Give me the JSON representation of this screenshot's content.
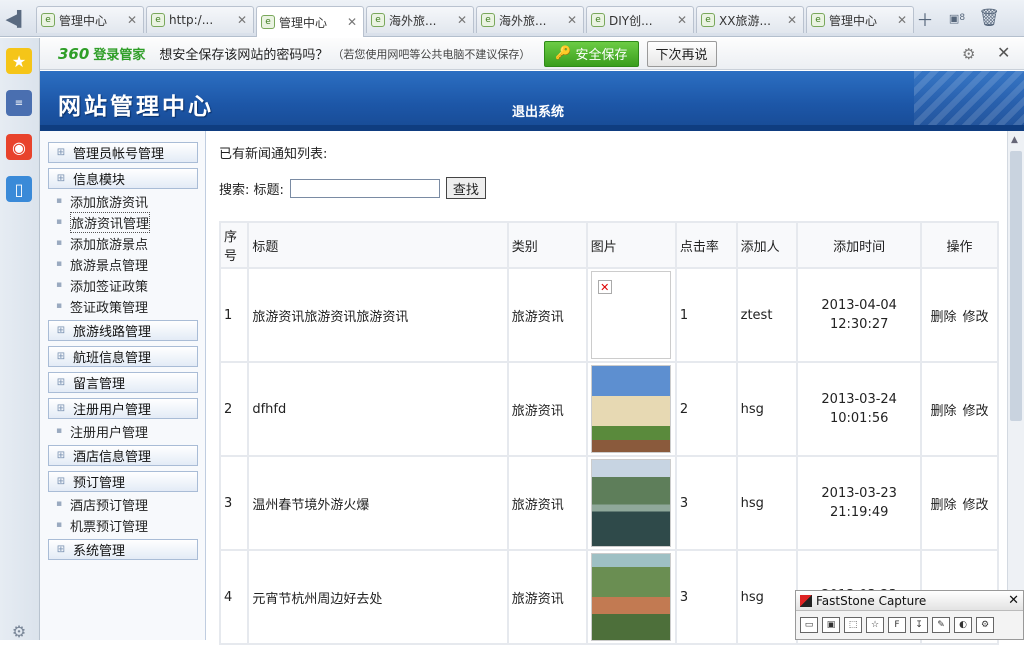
{
  "browser": {
    "tabs": [
      {
        "label": "管理中心",
        "active": false
      },
      {
        "label": "http:/...",
        "active": false
      },
      {
        "label": "管理中心",
        "active": true
      },
      {
        "label": "海外旅...",
        "active": false
      },
      {
        "label": "海外旅...",
        "active": false
      },
      {
        "label": "DIY创...",
        "active": false
      },
      {
        "label": "XX旅游...",
        "active": false
      },
      {
        "label": "管理中心",
        "active": false
      }
    ],
    "tab_count_badge": "8"
  },
  "password_bar": {
    "brand_logo": "360",
    "brand_name": "登录管家",
    "message": "想安全保存该网站的密码吗？",
    "hint": "（若您使用网吧等公共电脑不建议保存）",
    "save_label": "安全保存",
    "later_label": "下次再说"
  },
  "site": {
    "title": "网站管理中心",
    "logout": "退出系统"
  },
  "menu": {
    "items": [
      {
        "type": "head",
        "label": "管理员帐号管理"
      },
      {
        "type": "head",
        "label": "信息模块"
      },
      {
        "type": "sub",
        "label": "添加旅游资讯"
      },
      {
        "type": "sub",
        "label": "旅游资讯管理",
        "selected": true
      },
      {
        "type": "sub",
        "label": "添加旅游景点"
      },
      {
        "type": "sub",
        "label": "旅游景点管理"
      },
      {
        "type": "sub",
        "label": "添加签证政策"
      },
      {
        "type": "sub",
        "label": "签证政策管理"
      },
      {
        "type": "head",
        "label": "旅游线路管理"
      },
      {
        "type": "head",
        "label": "航班信息管理"
      },
      {
        "type": "head",
        "label": "留言管理"
      },
      {
        "type": "head",
        "label": "注册用户管理"
      },
      {
        "type": "sub",
        "label": "注册用户管理"
      },
      {
        "type": "head",
        "label": "酒店信息管理"
      },
      {
        "type": "head",
        "label": "预订管理"
      },
      {
        "type": "sub",
        "label": "酒店预订管理"
      },
      {
        "type": "sub",
        "label": "机票预订管理"
      },
      {
        "type": "head",
        "label": "系统管理"
      }
    ]
  },
  "content": {
    "list_title": "已有新闻通知列表:",
    "search_label": "搜索: 标题:",
    "search_value": "",
    "search_button": "查找",
    "columns": [
      "序号",
      "标题",
      "类别",
      "图片",
      "点击率",
      "添加人",
      "添加时间",
      "操作"
    ],
    "rows": [
      {
        "id": "1",
        "title": "旅游资讯旅游资讯旅游资讯",
        "category": "旅游资讯",
        "image": "broken",
        "clicks": "1",
        "author": "ztest",
        "date": "2013-04-04",
        "time": "12:30:27",
        "delete": "删除",
        "edit": "修改"
      },
      {
        "id": "2",
        "title": "dfhfd",
        "category": "旅游资讯",
        "image": "building-photo",
        "clicks": "2",
        "author": "hsg",
        "date": "2013-03-24",
        "time": "10:01:56",
        "delete": "删除",
        "edit": "修改"
      },
      {
        "id": "3",
        "title": "温州春节境外游火爆",
        "category": "旅游资讯",
        "image": "lake-photo",
        "clicks": "3",
        "author": "hsg",
        "date": "2013-03-23",
        "time": "21:19:49",
        "delete": "删除",
        "edit": "修改"
      },
      {
        "id": "4",
        "title": "元宵节杭州周边好去处",
        "category": "旅游资讯",
        "image": "cliff-photo",
        "clicks": "3",
        "author": "hsg",
        "date": "2013-03-23",
        "time": "",
        "delete": "",
        "edit": ""
      }
    ]
  },
  "overlay": {
    "title": "FastStone Capture"
  }
}
